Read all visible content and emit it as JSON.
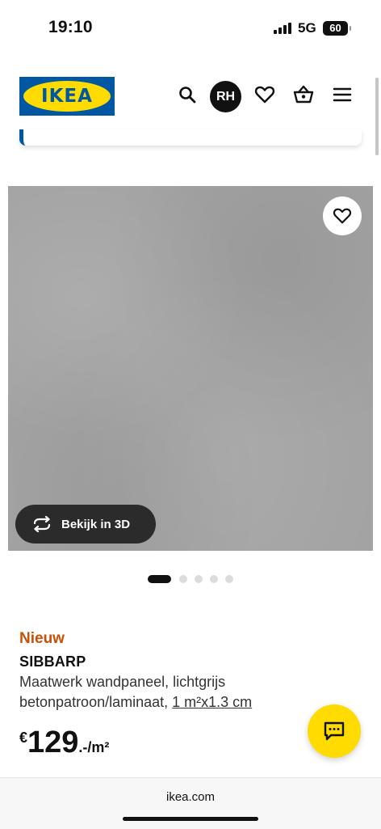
{
  "status_bar": {
    "time": "19:10",
    "network": "5G",
    "battery": "60"
  },
  "header": {
    "logo_text": "IKEA",
    "avatar_initials": "RH",
    "icons": [
      "search-icon",
      "user-avatar",
      "heart-icon",
      "basket-icon",
      "menu-icon"
    ]
  },
  "product": {
    "view_3d_label": "Bekijk in 3D",
    "image_count": 5,
    "active_image": 1,
    "badge": "Nieuw",
    "name": "SIBBARP",
    "description_text": "Maatwerk wandpaneel, lichtgrijs betonpatroon/laminaat, ",
    "size_link": "1 m²x1.3 cm",
    "price_currency": "€",
    "price_integer": "129",
    "price_unit": ".-/m²"
  },
  "browser": {
    "url": "ikea.com"
  },
  "colors": {
    "ikea_blue": "#0058a3",
    "ikea_yellow": "#ffdb00",
    "badge_orange": "#ca5008",
    "concrete_grey": "#a3a3a3"
  }
}
